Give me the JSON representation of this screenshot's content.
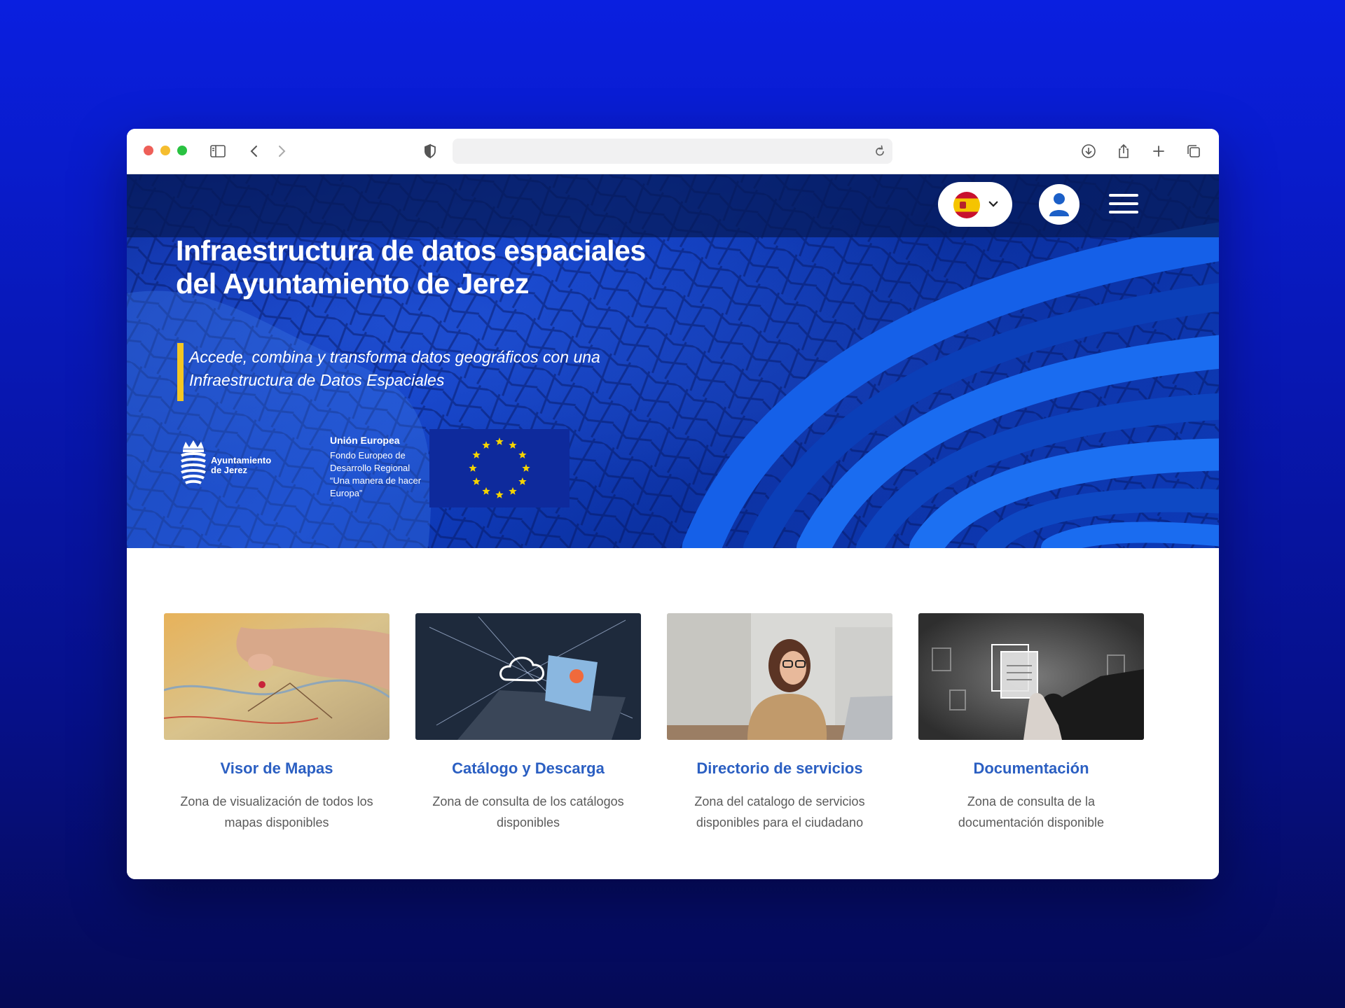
{
  "browser": {
    "url": "",
    "icons": {
      "sidebar": "sidebar-icon",
      "back": "chevron-left-icon",
      "forward": "chevron-right-icon",
      "privacy": "shield-icon",
      "reload": "reload-icon",
      "download": "download-icon",
      "share": "share-icon",
      "new_tab": "plus-icon",
      "tabs": "tabs-overview-icon"
    }
  },
  "header": {
    "language_flag": "spain-flag",
    "user_icon": "user-icon",
    "menu_icon": "hamburger-menu-icon"
  },
  "hero": {
    "title": "Infraestructura de datos espaciales del Ayuntamiento de Jerez",
    "subtitle": "Accede, combina y transforma datos geográficos con una Infraestructura de Datos Espaciales",
    "logo_name": "Ayuntamiento de Jerez",
    "eu_heading": "Unión Europea",
    "eu_line1": "Fondo Europeo de Desarrollo Regional",
    "eu_line2": "“Una manera de hacer Europa”"
  },
  "cards": [
    {
      "title": "Visor de Mapas",
      "description": "Zona de visualización de todos los mapas disponibles"
    },
    {
      "title": "Catálogo y Descarga",
      "description": "Zona de consulta de los catálogos disponibles"
    },
    {
      "title": "Directorio de servicios",
      "description": "Zona del catalogo de servicios disponibles para el ciudadano"
    },
    {
      "title": "Documentación",
      "description": "Zona de consulta de la documentación disponible"
    }
  ],
  "colors": {
    "accent": "#2b5fc2",
    "hero_bar": "#f3c623",
    "background": "#0a1fe0"
  }
}
